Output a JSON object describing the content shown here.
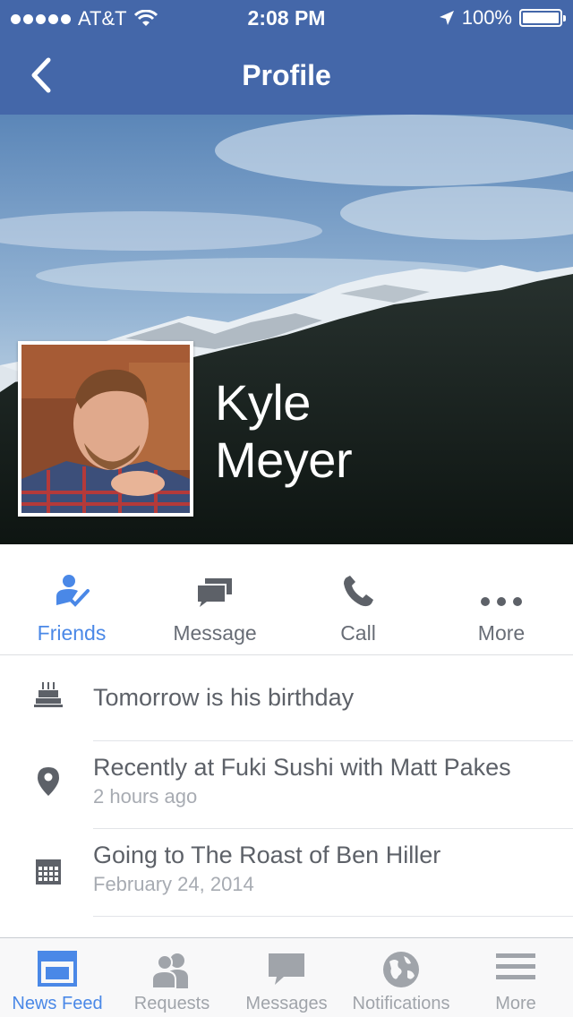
{
  "status_bar": {
    "carrier": "AT&T",
    "time": "2:08 PM",
    "battery": "100%"
  },
  "nav": {
    "title": "Profile",
    "back_icon": "chevron-left-icon"
  },
  "profile": {
    "first_name": "Kyle",
    "last_name": "Meyer"
  },
  "actions": [
    {
      "label": "Friends",
      "icon": "friends-icon",
      "active": true
    },
    {
      "label": "Message",
      "icon": "message-icon",
      "active": false
    },
    {
      "label": "Call",
      "icon": "phone-icon",
      "active": false
    },
    {
      "label": "More",
      "icon": "more-icon",
      "active": false
    }
  ],
  "info": [
    {
      "icon": "cake-icon",
      "title": "Tomorrow is his birthday",
      "subtitle": ""
    },
    {
      "icon": "location-pin-icon",
      "title": "Recently at Fuki Sushi with Matt Pakes",
      "subtitle": "2 hours ago"
    },
    {
      "icon": "calendar-icon",
      "title": "Going to The Roast of Ben Hiller",
      "subtitle": "February 24, 2014"
    }
  ],
  "tabs": [
    {
      "label": "News Feed",
      "icon": "news-feed-icon",
      "active": true
    },
    {
      "label": "Requests",
      "icon": "requests-icon",
      "active": false
    },
    {
      "label": "Messages",
      "icon": "messages-icon",
      "active": false
    },
    {
      "label": "Notifications",
      "icon": "globe-icon",
      "active": false
    },
    {
      "label": "More",
      "icon": "menu-icon",
      "active": false
    }
  ],
  "colors": {
    "header": "#4467a9",
    "accent": "#4a88e7",
    "icon_gray": "#5d6168",
    "tab_gray": "#a0a4aa"
  }
}
